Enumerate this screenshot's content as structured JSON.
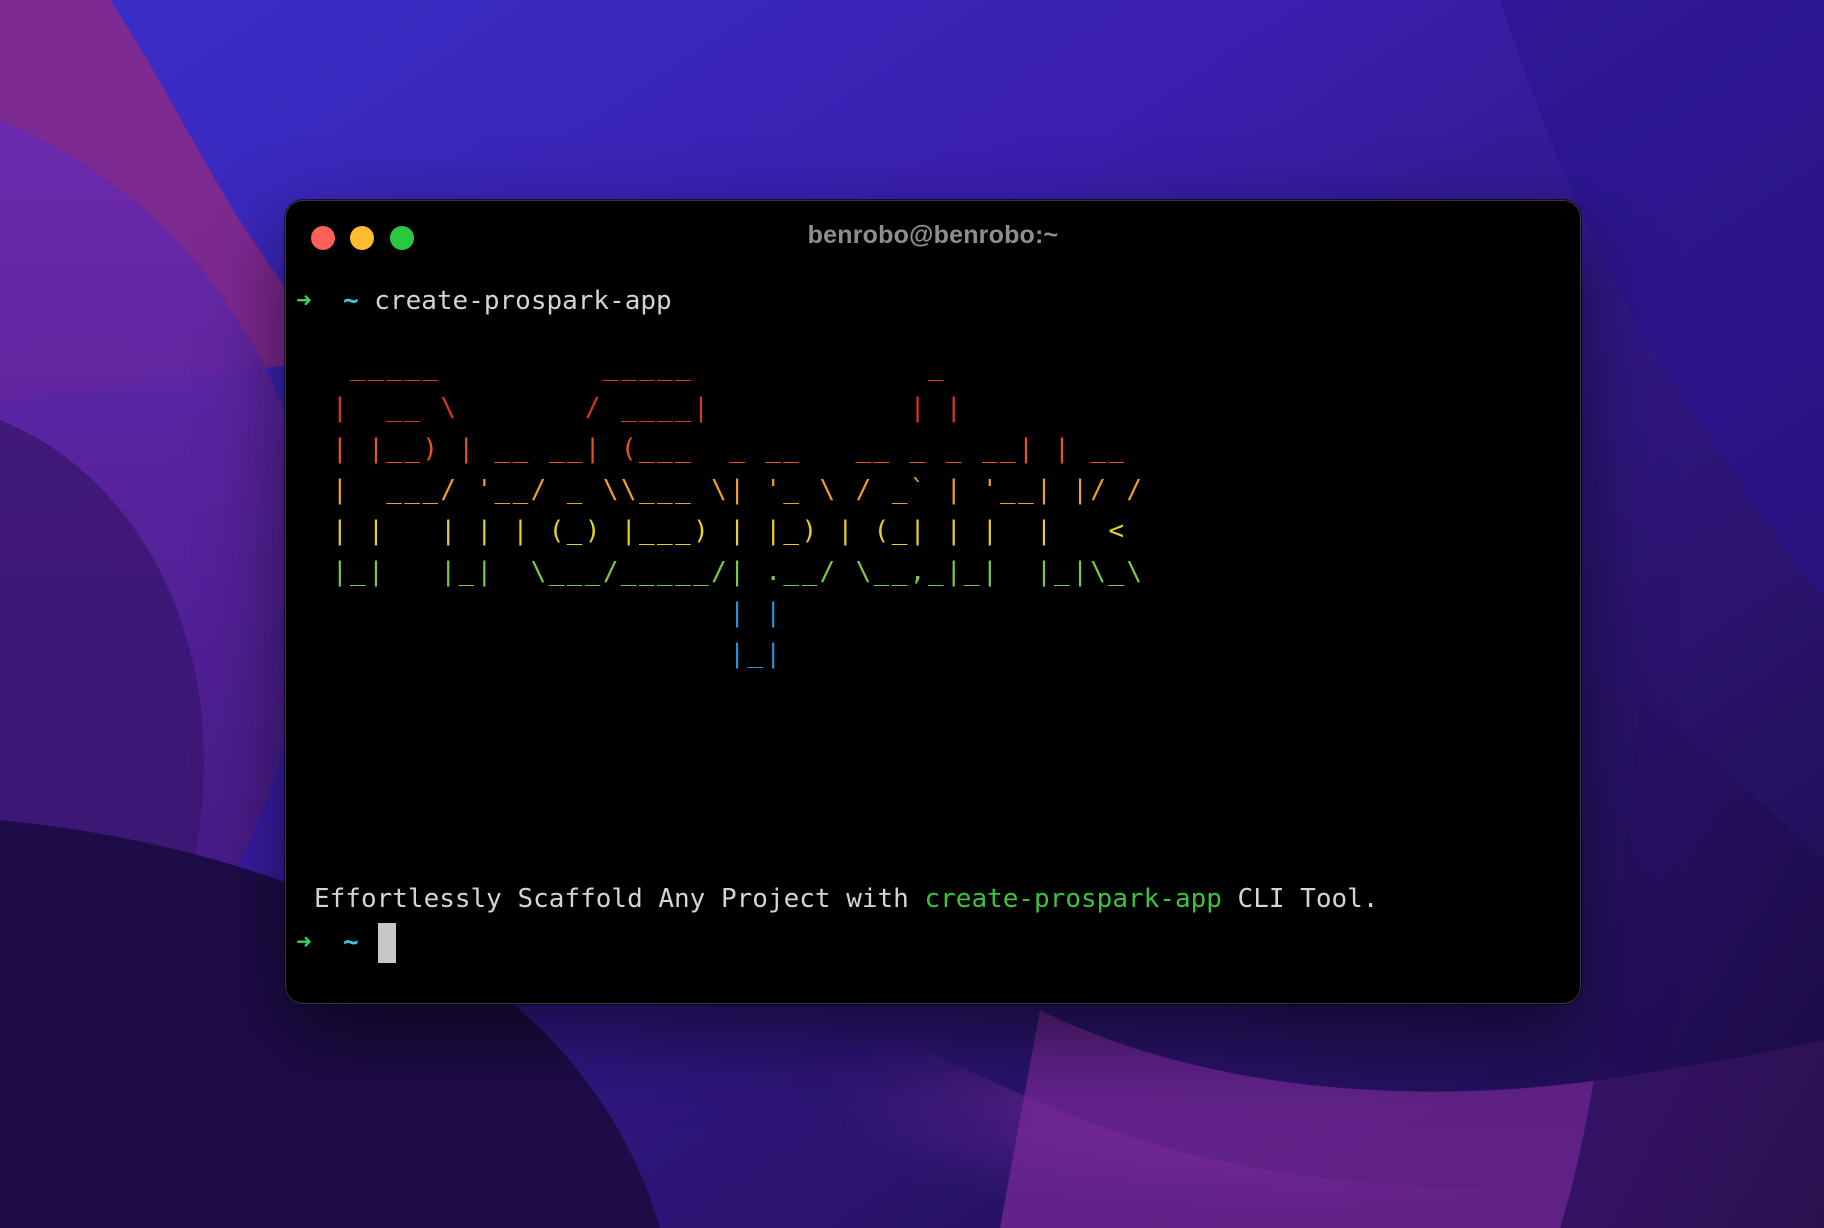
{
  "window": {
    "title": "benrobo@benrobo:~"
  },
  "terminal": {
    "prompt_arrow": "➜",
    "prompt_dir": "~",
    "command": "create-prospark-app",
    "ascii_art": [
      {
        "text": "  _____         _____             _",
        "color": "#e0312b"
      },
      {
        "text": " |  __ \\       / ____|           | |",
        "color": "#e0312b"
      },
      {
        "text": " | |__) | __ __| (___  _ __   __ _ _ __| | __",
        "color": "#e8541f"
      },
      {
        "text": " |  ___/ '__/ _ \\\\___ \\| '_ \\ / _` | '__| |/ /",
        "color": "#f0a020"
      },
      {
        "text": " | |   | | | (_) |___) | |_) | (_| | |  |   <",
        "color": "#e6d02a"
      },
      {
        "text": " |_|   |_|  \\___/_____/| .__/ \\__,_|_|  |_|\\_\\",
        "color": "#7cc94a"
      },
      {
        "text": "                       | |",
        "color": "#2f8fd6"
      },
      {
        "text": "                       |_|",
        "color": "#2f8fd6"
      }
    ],
    "tagline": {
      "before": "Effortlessly Scaffold Any Project with ",
      "highlight": "create-prospark-app",
      "after": " CLI Tool."
    }
  },
  "colors": {
    "arrow": "#3ccf5c",
    "tilde": "#39c8d6",
    "highlight": "#3cc23c",
    "close": "#fe5f57",
    "minimize": "#febc2e",
    "maximize": "#28c840"
  }
}
